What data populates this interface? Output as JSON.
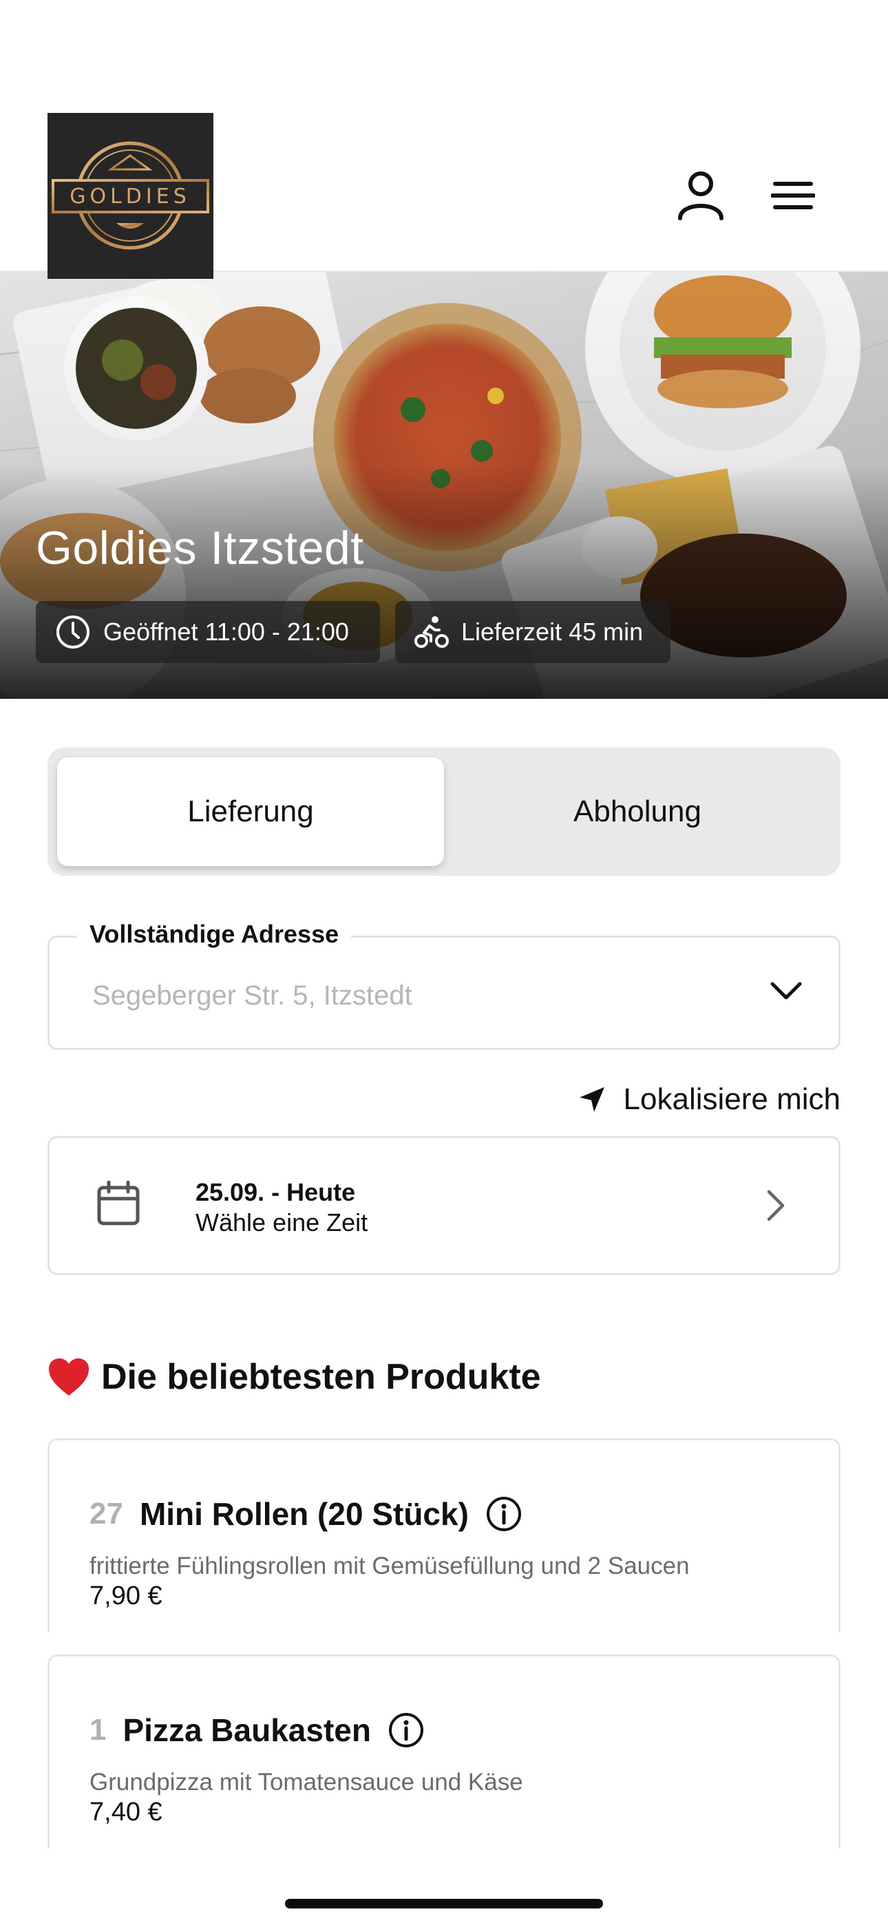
{
  "header": {
    "logo_text": "GOLDIES",
    "user_icon": "user-icon",
    "menu_icon": "hamburger-menu-icon"
  },
  "hero": {
    "restaurant_name": "Goldies Itzstedt",
    "opening_hours": "Geöffnet 11:00 - 21:00",
    "delivery_time": "Lieferzeit 45 min",
    "clock_icon": "clock-icon",
    "bike_icon": "cyclist-icon"
  },
  "order_mode": {
    "options": [
      "Lieferung",
      "Abholung"
    ],
    "selected": "Lieferung"
  },
  "address": {
    "label": "Vollständige Adresse",
    "placeholder": "Segeberger Str. 5, Itzstedt",
    "chevron_icon": "chevron-down-icon"
  },
  "locate": {
    "label": "Lokalisiere mich",
    "icon": "location-arrow-icon"
  },
  "schedule": {
    "title": "25.09. - Heute",
    "subtitle": "Wähle eine Zeit",
    "calendar_icon": "calendar-icon",
    "arrow_icon": "chevron-right-icon"
  },
  "popular": {
    "emoji": "❤️",
    "title": "Die beliebtesten Produkte",
    "products": [
      {
        "number": "27",
        "name": "Mini Rollen (20 Stück)",
        "description": "frittierte Fühlingsrollen mit Gemüsefüllung und 2 Saucen",
        "price": "7,90 €"
      },
      {
        "number": "1",
        "name": "Pizza Baukasten",
        "description": "Grundpizza mit Tomatensauce und Käse",
        "price": "7,40 €"
      }
    ]
  },
  "colors": {
    "logo_bg": "#262626",
    "logo_gold": "#c9975a",
    "segment_bg": "#e9e9e9",
    "border": "#e3e3e3",
    "muted_text": "#6b6b6b",
    "placeholder_text": "#b5b5b5"
  }
}
